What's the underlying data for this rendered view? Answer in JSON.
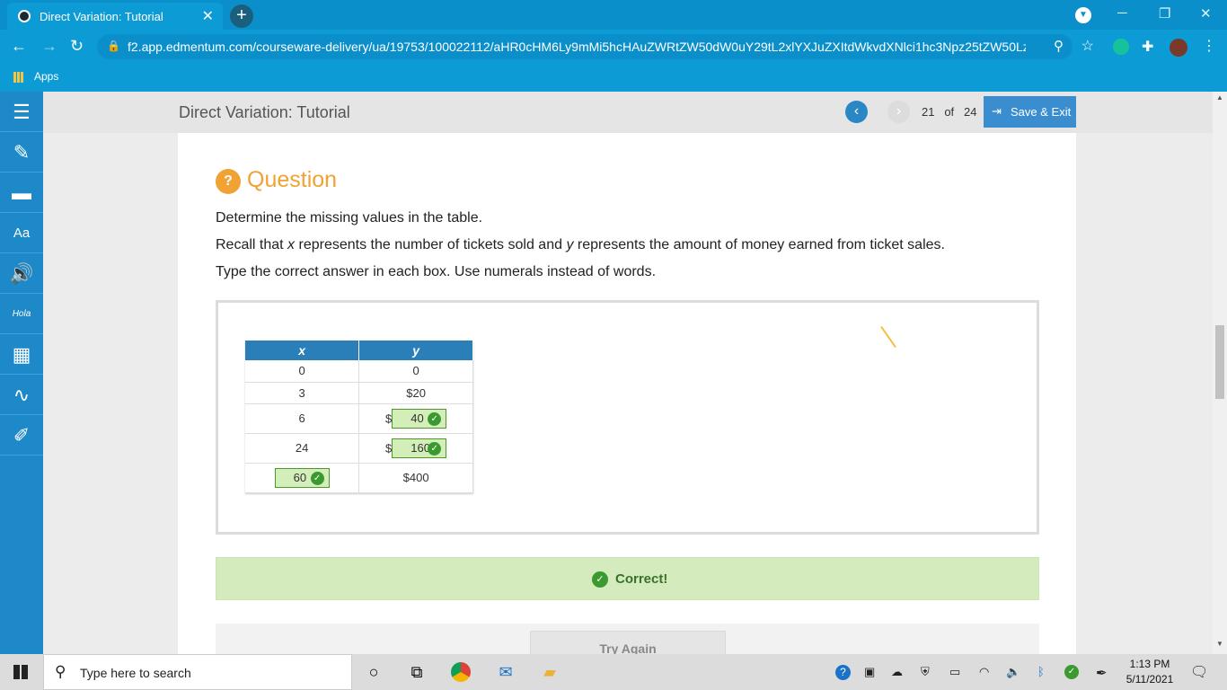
{
  "browser": {
    "tab_title": "Direct Variation: Tutorial",
    "url": "f2.app.edmentum.com/courseware-delivery/ua/19753/100022112/aHR0cHM6Ly9mMi5hcHAuZWRtZW50dW0uY29tL2xlYXJuZXItdWkvdXNlci1hc3Npz25tZW50LzE...",
    "bookmark_apps": "Apps"
  },
  "header": {
    "lesson_title": "Direct Variation: Tutorial",
    "page_current": "21",
    "page_of": "of",
    "page_total": "24",
    "save_exit": "Save & Exit"
  },
  "question": {
    "heading": "Question",
    "line1": "Determine the missing values in the table.",
    "line2_a": "Recall that ",
    "line2_x": "x",
    "line2_b": " represents the number of tickets sold and ",
    "line2_y": "y",
    "line2_c": " represents the amount of money earned from ticket sales.",
    "line3": "Type the correct answer in each box. Use numerals instead of words."
  },
  "table": {
    "col_x": "x",
    "col_y": "y",
    "rows": [
      {
        "x": "0",
        "y": "0"
      },
      {
        "x": "3",
        "y": "$20"
      },
      {
        "x": "6",
        "y_prefix": "$",
        "y_answer": "40"
      },
      {
        "x": "24",
        "y_prefix": "$",
        "y_answer": "160"
      },
      {
        "x_answer": "60",
        "y": "$400"
      }
    ]
  },
  "feedback": {
    "correct": "Correct!",
    "try_again": "Try Again"
  },
  "taskbar": {
    "search_placeholder": "Type here to search",
    "time": "1:13 PM",
    "date": "5/11/2021"
  },
  "colors": {
    "brand_blue": "#1e89c8",
    "question_orange": "#f0a332",
    "correct_green": "#3b9a2f"
  }
}
